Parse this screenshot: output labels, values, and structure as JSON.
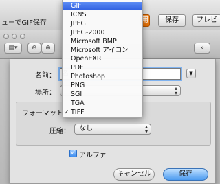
{
  "window": {
    "title": "ューでGIF保存"
  },
  "top_buttons": {
    "accent_label": "用",
    "save_label": "保存",
    "preview_label": "プレビ"
  },
  "toolbar": {
    "view_icon": "view-mode-icon",
    "zoom_out": "zoom-out-icon",
    "zoom_in": "zoom-in-icon"
  },
  "sheet": {
    "name_label": "名前：",
    "name_value": "名",
    "location_label": "場所：",
    "format_label": "フォーマット：",
    "compression_label": "圧縮：",
    "compression_value": "なし",
    "alpha_label": "アルファ",
    "cancel_label": "キャンセル",
    "save_label": "保存"
  },
  "format_menu": {
    "items": [
      {
        "label": "GIF",
        "selected": true,
        "checked": false
      },
      {
        "label": "ICNS",
        "selected": false,
        "checked": false
      },
      {
        "label": "JPEG",
        "selected": false,
        "checked": false
      },
      {
        "label": "JPEG-2000",
        "selected": false,
        "checked": false
      },
      {
        "label": "Microsoft BMP",
        "selected": false,
        "checked": false
      },
      {
        "label": "Microsoft アイコン",
        "selected": false,
        "checked": false
      },
      {
        "label": "OpenEXR",
        "selected": false,
        "checked": false
      },
      {
        "label": "PDF",
        "selected": false,
        "checked": false
      },
      {
        "label": "Photoshop",
        "selected": false,
        "checked": false
      },
      {
        "label": "PNG",
        "selected": false,
        "checked": false
      },
      {
        "label": "SGI",
        "selected": false,
        "checked": false
      },
      {
        "label": "TGA",
        "selected": false,
        "checked": false
      },
      {
        "label": "TIFF",
        "selected": false,
        "checked": true
      }
    ]
  },
  "colors": {
    "accent": "#e06a00",
    "selection": "#2f5fe0",
    "focus_ring": "#7fb2ef"
  }
}
